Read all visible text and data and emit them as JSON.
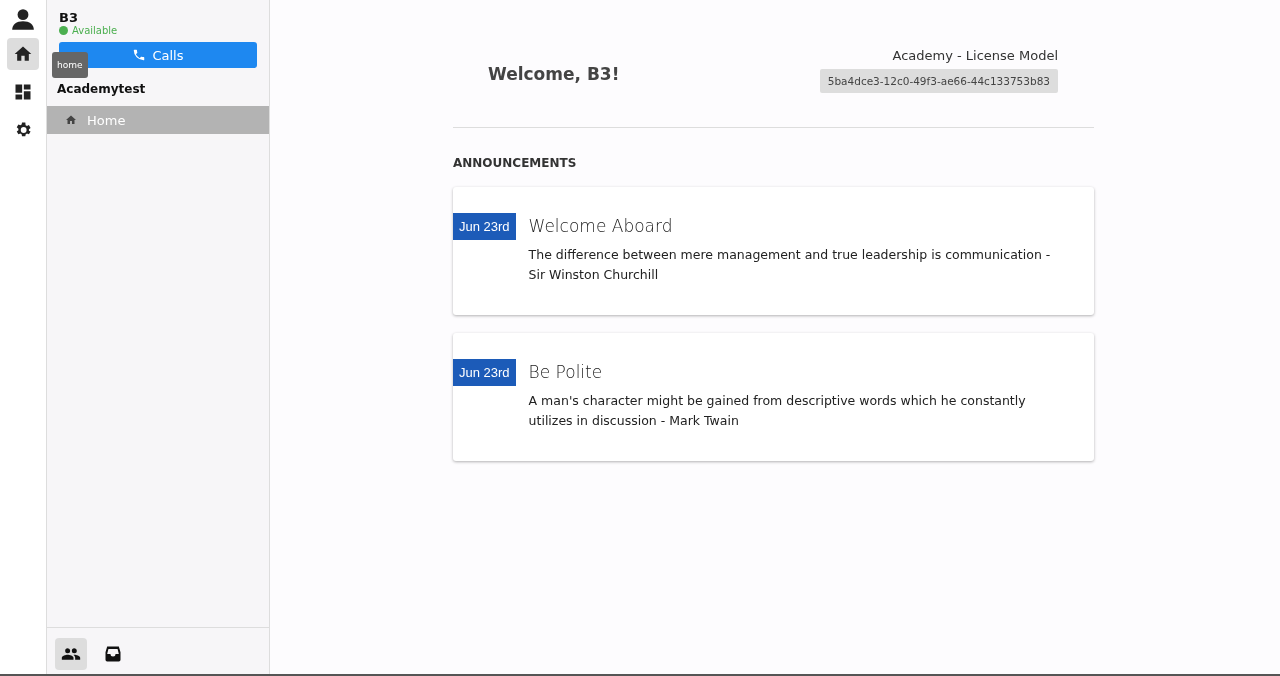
{
  "rail": {
    "items": [
      {
        "kind": "home",
        "selected": true
      },
      {
        "kind": "dashboard",
        "selected": false
      },
      {
        "kind": "settings",
        "selected": false
      }
    ],
    "tooltip": "home"
  },
  "user": {
    "name": "B3",
    "status": {
      "label": "Available",
      "color": "#4caf50"
    }
  },
  "calls_button": "Calls",
  "workspace": "Academytest",
  "nav": [
    {
      "label": "Home",
      "selected": true
    }
  ],
  "bottom_tabs": [
    {
      "kind": "team",
      "selected": true
    },
    {
      "kind": "inbox",
      "selected": false
    }
  ],
  "header": {
    "welcome": "Welcome, B3!",
    "license": "Academy - License Model",
    "license_id": "5ba4dce3-12c0-49f3-ae66-44c133753b83"
  },
  "announcements": {
    "heading": "ANNOUNCEMENTS",
    "items": [
      {
        "date": "Jun 23rd",
        "title": "Welcome Aboard",
        "body": "The difference between mere management and true leadership is communication - Sir Winston Churchill"
      },
      {
        "date": "Jun 23rd",
        "title": "Be Polite",
        "body": "A man's character might be gained from descriptive words which he constantly utilizes in discussion - Mark Twain"
      }
    ]
  }
}
